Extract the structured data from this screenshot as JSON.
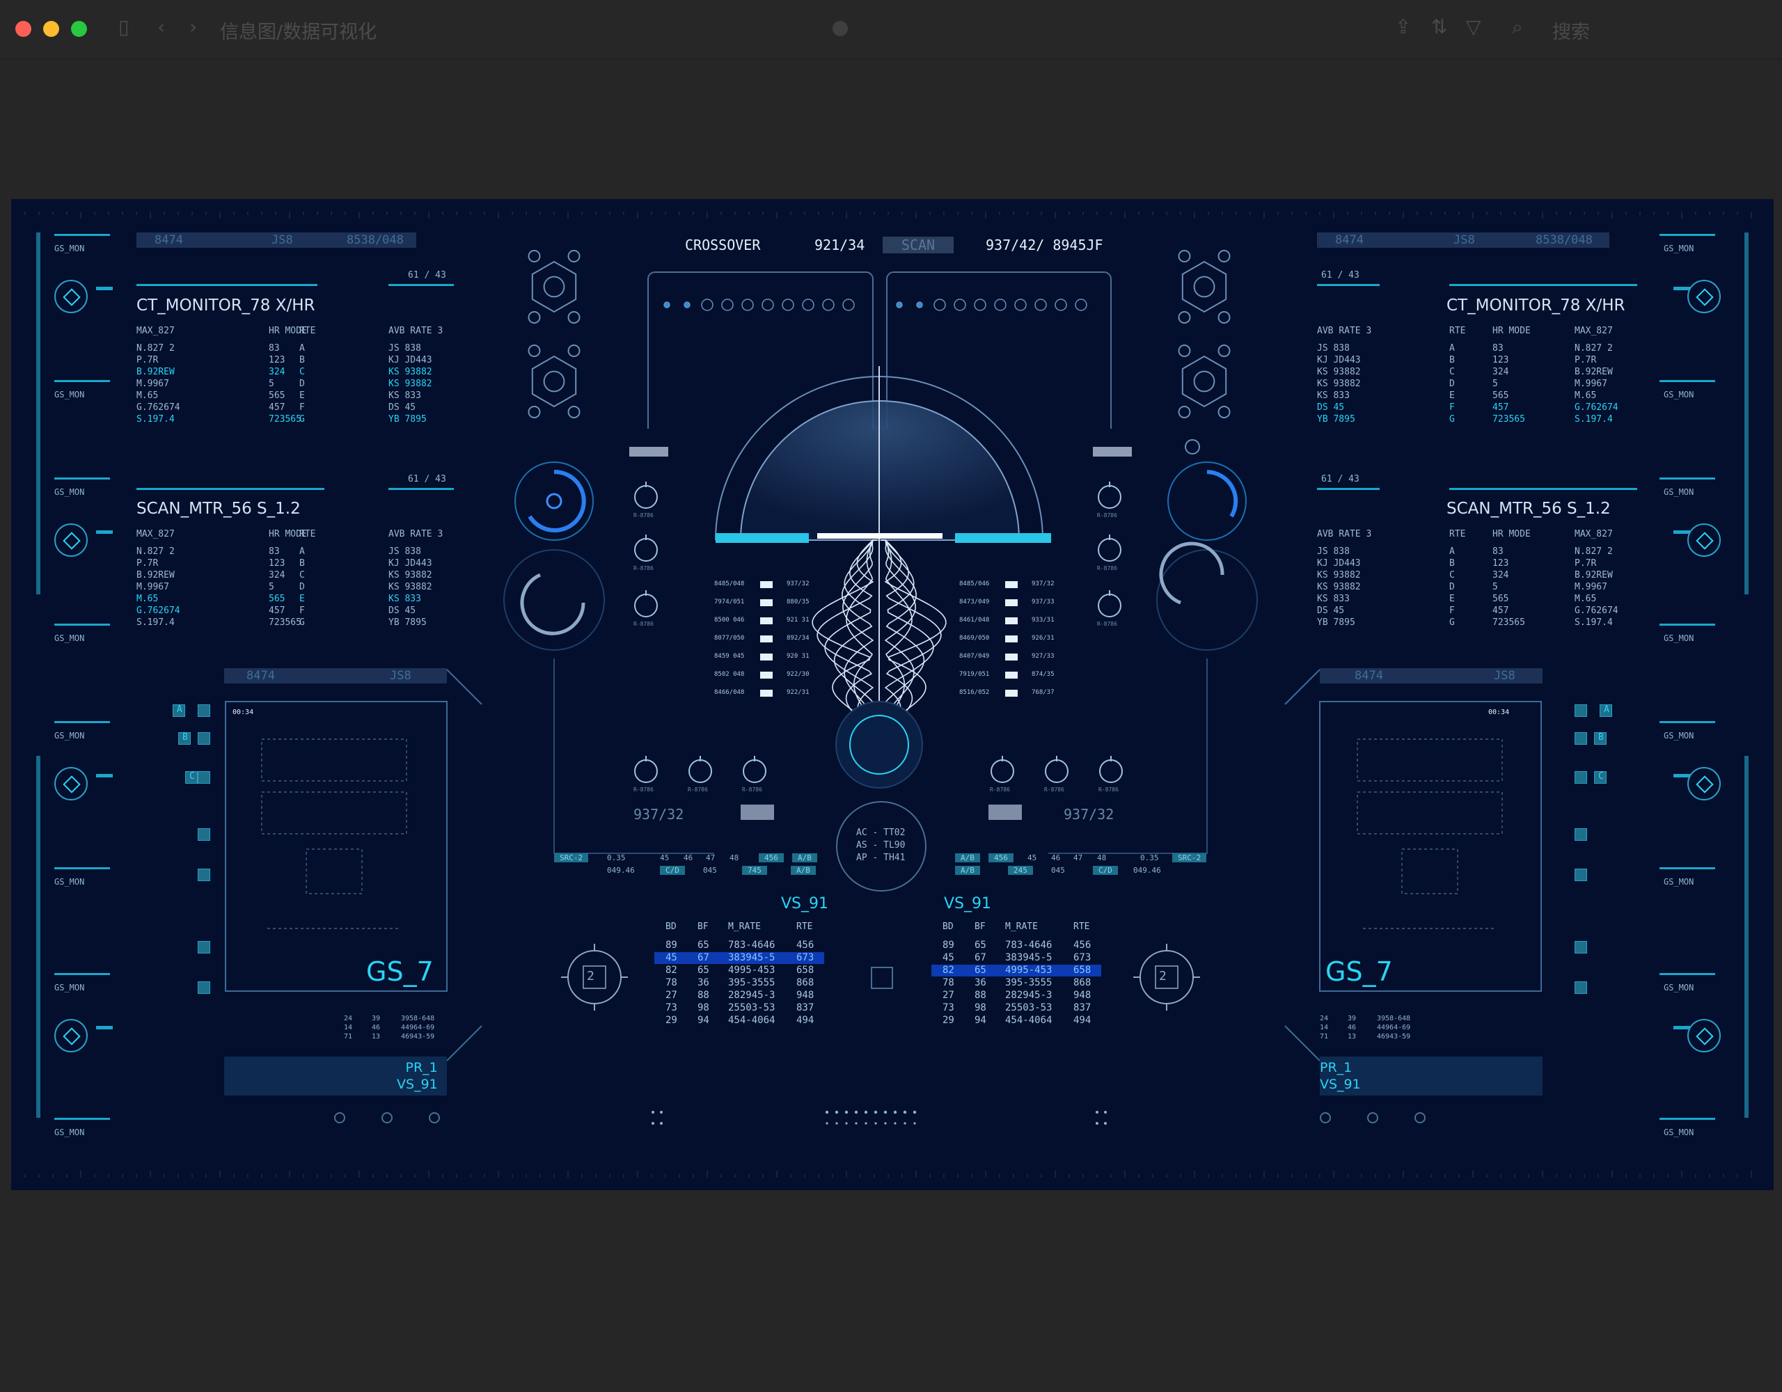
{
  "window": {
    "title": "信息图/数据可视化",
    "search_placeholder": "搜索",
    "back_icon": "chevron-left-icon",
    "forward_icon": "chevron-right-icon"
  },
  "top": {
    "left_bar": [
      "8474",
      "JS8",
      "8538/048"
    ],
    "right_bar": [
      "8474",
      "JS8",
      "8538/048"
    ],
    "center_label": "CROSSOVER",
    "center_code1": "921/34",
    "center_scan": "SCAN",
    "center_code2": "937/42/ 8945JF",
    "ratio": "61 / 43"
  },
  "gs_mon": "GS_MON",
  "panels": {
    "left_top": {
      "title": "CT_MONITOR_78 X/HR",
      "headers": [
        "MAX_827",
        "HR MODE",
        "RTE",
        "AVB RATE 3"
      ],
      "rows": [
        [
          "N.827 2",
          "83",
          "A",
          "JS 838"
        ],
        [
          "P.7R",
          "123",
          "B",
          "KJ JD443"
        ],
        [
          "B.92REW",
          "324",
          "C",
          "KS 93882"
        ],
        [
          "M.9967",
          "5",
          "D",
          "KS 93882"
        ],
        [
          "M.65",
          "565",
          "E",
          "KS 833"
        ],
        [
          "G.762674",
          "457",
          "F",
          "DS 45"
        ],
        [
          "S.197.4",
          "723565",
          "G",
          "YB 7895"
        ]
      ]
    },
    "left_mid": {
      "title": "SCAN_MTR_56 S_1.2",
      "headers": [
        "MAX_827",
        "HR MODE",
        "RTE",
        "AVB RATE 3"
      ],
      "rows": [
        [
          "N.827 2",
          "83",
          "A",
          "JS 838"
        ],
        [
          "P.7R",
          "123",
          "B",
          "KJ JD443"
        ],
        [
          "B.92REW",
          "324",
          "C",
          "KS 93882"
        ],
        [
          "M.9967",
          "5",
          "D",
          "KS 93882"
        ],
        [
          "M.65",
          "565",
          "E",
          "KS 833"
        ],
        [
          "G.762674",
          "457",
          "F",
          "DS 45"
        ],
        [
          "S.197.4",
          "723565",
          "G",
          "YB 7895"
        ]
      ]
    },
    "right_top": {
      "title": "CT_MONITOR_78 X/HR",
      "headers": [
        "AVB RATE 3",
        "RTE",
        "HR MODE",
        "MAX_827"
      ],
      "rows": [
        [
          "JS 838",
          "A",
          "83",
          "N.827 2"
        ],
        [
          "KJ JD443",
          "B",
          "123",
          "P.7R"
        ],
        [
          "KS 93882",
          "C",
          "324",
          "B.92REW"
        ],
        [
          "KS 93882",
          "D",
          "5",
          "M.9967"
        ],
        [
          "KS 833",
          "E",
          "565",
          "M.65"
        ],
        [
          "DS 45",
          "F",
          "457",
          "G.762674"
        ],
        [
          "YB 7895",
          "G",
          "723565",
          "S.197.4"
        ]
      ]
    },
    "right_mid": {
      "title": "SCAN_MTR_56 S_1.2",
      "headers": [
        "AVB RATE 3",
        "RTE",
        "HR MODE",
        "MAX_827"
      ],
      "rows": [
        [
          "JS 838",
          "A",
          "83",
          "N.827 2"
        ],
        [
          "KJ JD443",
          "B",
          "123",
          "P.7R"
        ],
        [
          "KS 93882",
          "C",
          "324",
          "B.92REW"
        ],
        [
          "KS 93882",
          "D",
          "5",
          "M.9967"
        ],
        [
          "KS 833",
          "E",
          "565",
          "M.65"
        ],
        [
          "DS 45",
          "F",
          "457",
          "G.762674"
        ],
        [
          "YB 7895",
          "G",
          "723565",
          "S.197.4"
        ]
      ]
    }
  },
  "gs_panels": {
    "left_bar": [
      "8474",
      "JS8"
    ],
    "right_bar": [
      "8474",
      "JS8"
    ],
    "time": "00:34",
    "label": "GS_7",
    "foot_rows": [
      [
        "24",
        "39",
        "3958-648"
      ],
      [
        "14",
        "46",
        "44964-69"
      ],
      [
        "71",
        "13",
        "46943-59"
      ]
    ],
    "pr_label": "PR_1",
    "vs_label": "VS_91",
    "side_letters": [
      "A",
      "B",
      "C"
    ]
  },
  "center": {
    "code_left": "937/32",
    "code_right": "937/32",
    "knob_label": "R-8786",
    "left_list": [
      "8485/048",
      "7974/051",
      "8500 046",
      "8077/050",
      "8459 045",
      "8502 048",
      "8466/048"
    ],
    "left_list_r": [
      "937/32",
      "880/35",
      "921 31",
      "892/34",
      "920 31",
      "922/30",
      "922/31"
    ],
    "right_list": [
      "8485/046",
      "8473/049",
      "8461/048",
      "8469/050",
      "8407/049",
      "7919/051",
      "8516/052"
    ],
    "right_list_r": [
      "937/32",
      "937/33",
      "933/31",
      "926/31",
      "927/33",
      "874/35",
      "768/37"
    ],
    "ac": [
      "AC - TT02",
      "AS - TL90",
      "AP - TH41"
    ],
    "strip_left": [
      "0.35",
      "45",
      "46",
      "47",
      "48",
      "456",
      "A/B"
    ],
    "strip_left2": [
      "049.46",
      "C/D",
      "045",
      "745",
      "A/B"
    ],
    "strip_right": [
      "A/B",
      "456",
      "45",
      "46",
      "47",
      "48",
      "0.35"
    ],
    "strip_right2": [
      "A/B",
      "245",
      "045",
      "C/D",
      "049.46"
    ],
    "src": "SRC-2"
  },
  "vs_tables": {
    "title": "VS_91",
    "headers": [
      "BD",
      "BF",
      "M_RATE",
      "RTE"
    ],
    "rows": [
      [
        "89",
        "65",
        "783-4646",
        "456"
      ],
      [
        "45",
        "67",
        "383945-5",
        "673"
      ],
      [
        "82",
        "65",
        "4995-453",
        "658"
      ],
      [
        "78",
        "36",
        "395-3555",
        "868"
      ],
      [
        "27",
        "88",
        "282945-3",
        "948"
      ],
      [
        "73",
        "98",
        "25503-53",
        "837"
      ],
      [
        "29",
        "94",
        "454-4064",
        "494"
      ]
    ],
    "left_selected": 1,
    "right_selected": 2,
    "dial_value": "2"
  },
  "colors": {
    "background": "#030f2d",
    "accent": "#2ad4f5",
    "panel_line": "#1aa7cc",
    "highlight": "#0c3bb3"
  }
}
